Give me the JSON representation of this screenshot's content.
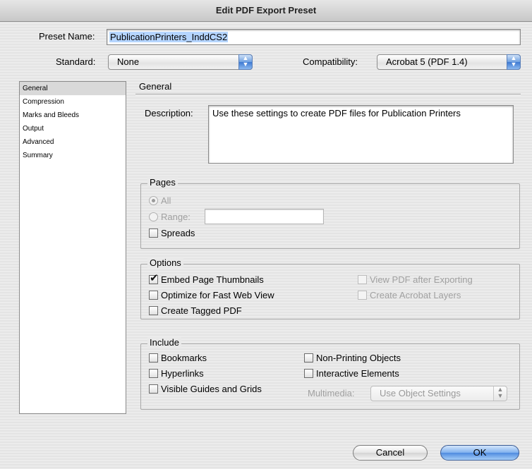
{
  "window": {
    "title": "Edit PDF Export Preset"
  },
  "preset": {
    "label": "Preset Name:",
    "value": "PublicationPrinters_InddCS2"
  },
  "standard": {
    "label": "Standard:",
    "value": "None"
  },
  "compatibility": {
    "label": "Compatibility:",
    "value": "Acrobat 5 (PDF 1.4)"
  },
  "sidebar": {
    "items": [
      {
        "label": "General",
        "active": true
      },
      {
        "label": "Compression"
      },
      {
        "label": "Marks and Bleeds"
      },
      {
        "label": "Output"
      },
      {
        "label": "Advanced"
      },
      {
        "label": "Summary"
      }
    ]
  },
  "general": {
    "title": "General",
    "description_label": "Description:",
    "description_value": "Use these settings to create PDF files for Publication Printers"
  },
  "pages": {
    "title": "Pages",
    "all_label": "All",
    "range_label": "Range:",
    "range_value": "",
    "spreads_label": "Spreads"
  },
  "options": {
    "title": "Options",
    "embed_thumbnails": "Embed Page Thumbnails",
    "optimize_web": "Optimize for Fast Web View",
    "tagged_pdf": "Create Tagged PDF",
    "view_after": "View PDF after Exporting",
    "acrobat_layers": "Create Acrobat Layers"
  },
  "include": {
    "title": "Include",
    "bookmarks": "Bookmarks",
    "hyperlinks": "Hyperlinks",
    "guides_grids": "Visible Guides and Grids",
    "non_printing": "Non-Printing Objects",
    "interactive": "Interactive Elements",
    "multimedia_label": "Multimedia:",
    "multimedia_value": "Use Object Settings"
  },
  "buttons": {
    "cancel": "Cancel",
    "ok": "OK"
  }
}
